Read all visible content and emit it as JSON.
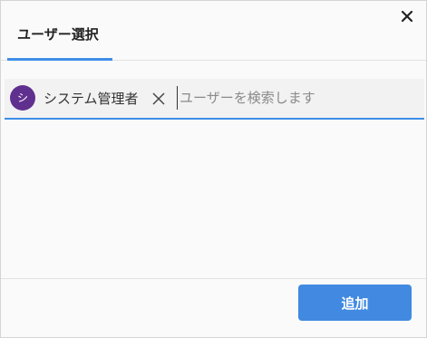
{
  "dialog": {
    "close_icon": "close-icon"
  },
  "tabs": [
    {
      "label": "ユーザー選択",
      "active": true
    }
  ],
  "picker": {
    "selected_users": [
      {
        "avatar_initial": "シ",
        "name": "システム管理者",
        "avatar_color": "#60308f",
        "remove_icon": "remove-icon"
      }
    ],
    "search_value": "",
    "search_placeholder": "ユーザーを検索します"
  },
  "footer": {
    "add_label": "追加"
  },
  "colors": {
    "accent": "#3f8ee8",
    "button": "#4189e1",
    "avatar": "#60308f"
  }
}
